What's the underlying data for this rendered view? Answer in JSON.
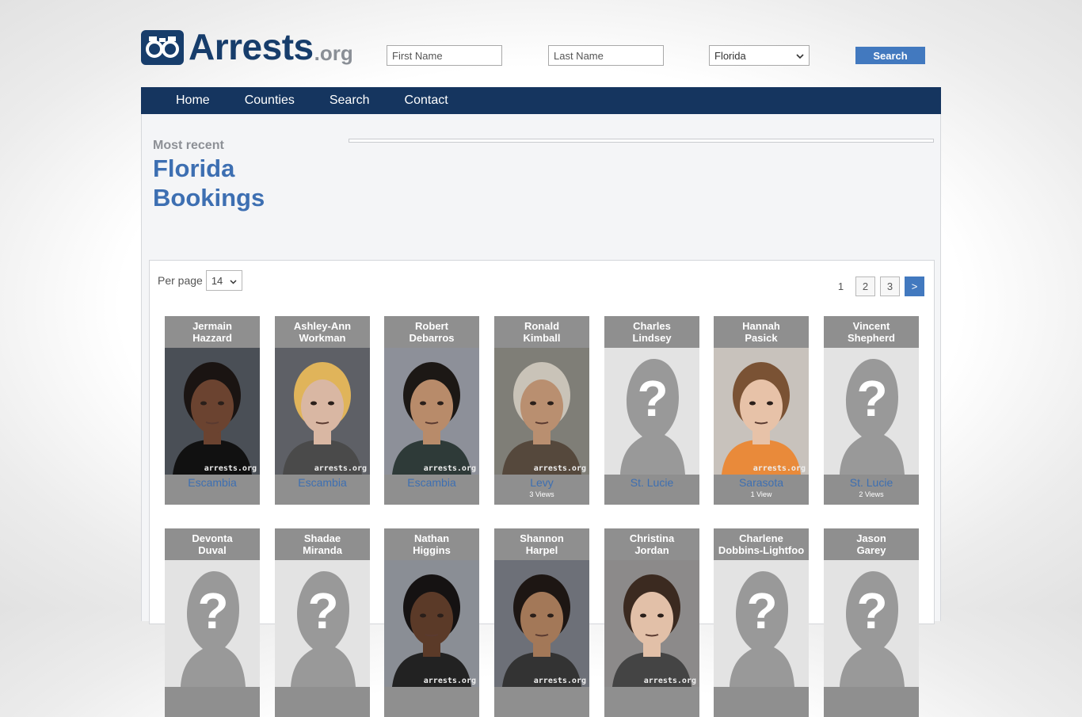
{
  "logo": {
    "text": "Arrests",
    "suffix": ".org"
  },
  "search": {
    "first_placeholder": "First Name",
    "last_placeholder": "Last Name",
    "state_value": "Florida",
    "button_label": "Search"
  },
  "nav": [
    "Home",
    "Counties",
    "Search",
    "Contact"
  ],
  "heading": {
    "most_recent": "Most recent",
    "title_line1": "Florida",
    "title_line2": "Bookings"
  },
  "list": {
    "per_page_label": "Per page",
    "per_page_value": "14",
    "pages": [
      "1",
      "2",
      "3"
    ],
    "next_label": ">"
  },
  "watermark": "arrests.org",
  "colors": {
    "brand": "#173d6b",
    "nav": "#15355f",
    "link": "#3d6fb2",
    "button": "#4279bf",
    "card": "#8f8f8f"
  },
  "bookings_row1": [
    {
      "first": "Jermain",
      "last": "Hazzard",
      "county": "Escambia",
      "views": "",
      "photo": "photo",
      "skin": "#6b4330",
      "bg": "#4a4f56",
      "hair": "#1a1412",
      "shirt": "#111111"
    },
    {
      "first": "Ashley-Ann",
      "last": "Workman",
      "county": "Escambia",
      "views": "",
      "photo": "photo",
      "skin": "#d9b7a3",
      "bg": "#5e6066",
      "hair": "#e0b45a",
      "shirt": "#4a4a4a"
    },
    {
      "first": "Robert",
      "last": "Debarros",
      "county": "Escambia",
      "views": "",
      "photo": "photo",
      "skin": "#b88b6a",
      "bg": "#8d9099",
      "hair": "#1c1815",
      "shirt": "#2e3a38"
    },
    {
      "first": "Ronald",
      "last": "Kimball",
      "county": "Levy",
      "views": "3 Views",
      "photo": "photo",
      "skin": "#b98f70",
      "bg": "#7f7e77",
      "hair": "#c9c3b8",
      "shirt": "#55483c"
    },
    {
      "first": "Charles",
      "last": "Lindsey",
      "county": "St. Lucie",
      "views": "",
      "photo": "placeholder"
    },
    {
      "first": "Hannah",
      "last": "Pasick",
      "county": "Sarasota",
      "views": "1 View",
      "photo": "photo",
      "skin": "#e7c2a8",
      "bg": "#c8c2bc",
      "hair": "#7a5234",
      "shirt": "#e98a3a"
    },
    {
      "first": "Vincent",
      "last": "Shepherd",
      "county": "St. Lucie",
      "views": "2 Views",
      "photo": "placeholder"
    }
  ],
  "bookings_row2": [
    {
      "first": "Devonta",
      "last": "Duval",
      "photo": "placeholder"
    },
    {
      "first": "Shadae",
      "last": "Miranda",
      "photo": "placeholder"
    },
    {
      "first": "Nathan",
      "last": "Higgins",
      "photo": "photo",
      "skin": "#5b3a28",
      "bg": "#8a8e95",
      "hair": "#151212",
      "shirt": "#222222"
    },
    {
      "first": "Shannon",
      "last": "Harpel",
      "photo": "photo",
      "skin": "#a37858",
      "bg": "#6d7078",
      "hair": "#1d1613",
      "shirt": "#333333"
    },
    {
      "first": "Christina",
      "last": "Jordan",
      "photo": "photo",
      "skin": "#e2c0a8",
      "bg": "#8c8a8a",
      "hair": "#3b2a20",
      "shirt": "#444444"
    },
    {
      "first": "Charlene",
      "last": "Dobbins-Lightfoo",
      "photo": "placeholder"
    },
    {
      "first": "Jason",
      "last": "Garey",
      "photo": "placeholder"
    }
  ]
}
